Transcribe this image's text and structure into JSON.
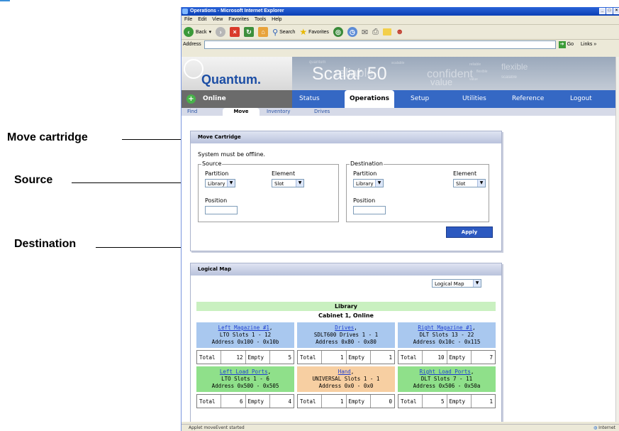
{
  "annotations": {
    "move_cartridge": "Move cartridge",
    "source": "Source",
    "destination": "Destination"
  },
  "browser": {
    "title": "Operations - Microsoft Internet Explorer",
    "menu": [
      "File",
      "Edit",
      "View",
      "Favorites",
      "Tools",
      "Help"
    ],
    "toolbar": {
      "back": "Back",
      "search": "Search",
      "favorites": "Favorites"
    },
    "address_label": "Address",
    "go": "Go",
    "links": "Links",
    "status": "Applet moveEvent started",
    "zone": "Internet"
  },
  "app": {
    "logo": "Quantum.",
    "product": "Scalar 50",
    "banner_words": [
      "reliable",
      "confident",
      "value",
      "flexible",
      "scalable",
      "quantum",
      "scalable",
      "reliable",
      "flexible",
      "value"
    ],
    "status": "Online",
    "nav": [
      "Status",
      "Operations",
      "Setup",
      "Utilities",
      "Reference",
      "Logout"
    ],
    "active_nav": "Operations",
    "subnav": [
      "Find",
      "Move",
      "Inventory",
      "Drives"
    ],
    "active_subnav": "Move"
  },
  "move_panel": {
    "header": "Move Cartridge",
    "notice": "System must be offline.",
    "source": {
      "legend": "Source",
      "partition_label": "Partition",
      "partition_value": "Library",
      "element_label": "Element",
      "element_value": "Slot",
      "position_label": "Position",
      "position_value": ""
    },
    "destination": {
      "legend": "Destination",
      "partition_label": "Partition",
      "partition_value": "Library",
      "element_label": "Element",
      "element_value": "Slot",
      "position_label": "Position",
      "position_value": ""
    },
    "apply": "Apply"
  },
  "map_panel": {
    "header": "Logical Map",
    "view_select": "Logical Map",
    "library_title": "Library",
    "cabinet": "Cabinet 1, Online",
    "cells": [
      {
        "name": "Left Magazine #1",
        "line2": "LTO Slots 1 - 12",
        "line3": "Address 0x100 - 0x10b",
        "total": "12",
        "empty": "5",
        "color": "#a9c8ef"
      },
      {
        "name": "Drives",
        "line2": "SDLT600 Drives 1 - 1",
        "line3": "Address 0x80 - 0x80",
        "total": "1",
        "empty": "1",
        "color": "#a9c8ef"
      },
      {
        "name": "Right Magazine #1",
        "line2": "DLT Slots 13 - 22",
        "line3": "Address 0x10c - 0x115",
        "total": "10",
        "empty": "7",
        "color": "#a9c8ef"
      },
      {
        "name": "Left Load Ports",
        "line2": "LTO Slots 1 - 6",
        "line3": "Address 0x500 - 0x505",
        "total": "6",
        "empty": "4",
        "color": "#8fe08a"
      },
      {
        "name": "Hand",
        "line2": "UNIVERSAL Slots 1 - 1",
        "line3": "Address 0x0 - 0x0",
        "total": "1",
        "empty": "0",
        "color": "#f7cfa2"
      },
      {
        "name": "Right Load Ports",
        "line2": "DLT Slots 7 - 11",
        "line3": "Address 0x506 - 0x50a",
        "total": "5",
        "empty": "1",
        "color": "#8fe08a"
      }
    ],
    "total_label": "Total",
    "empty_label": "Empty"
  }
}
